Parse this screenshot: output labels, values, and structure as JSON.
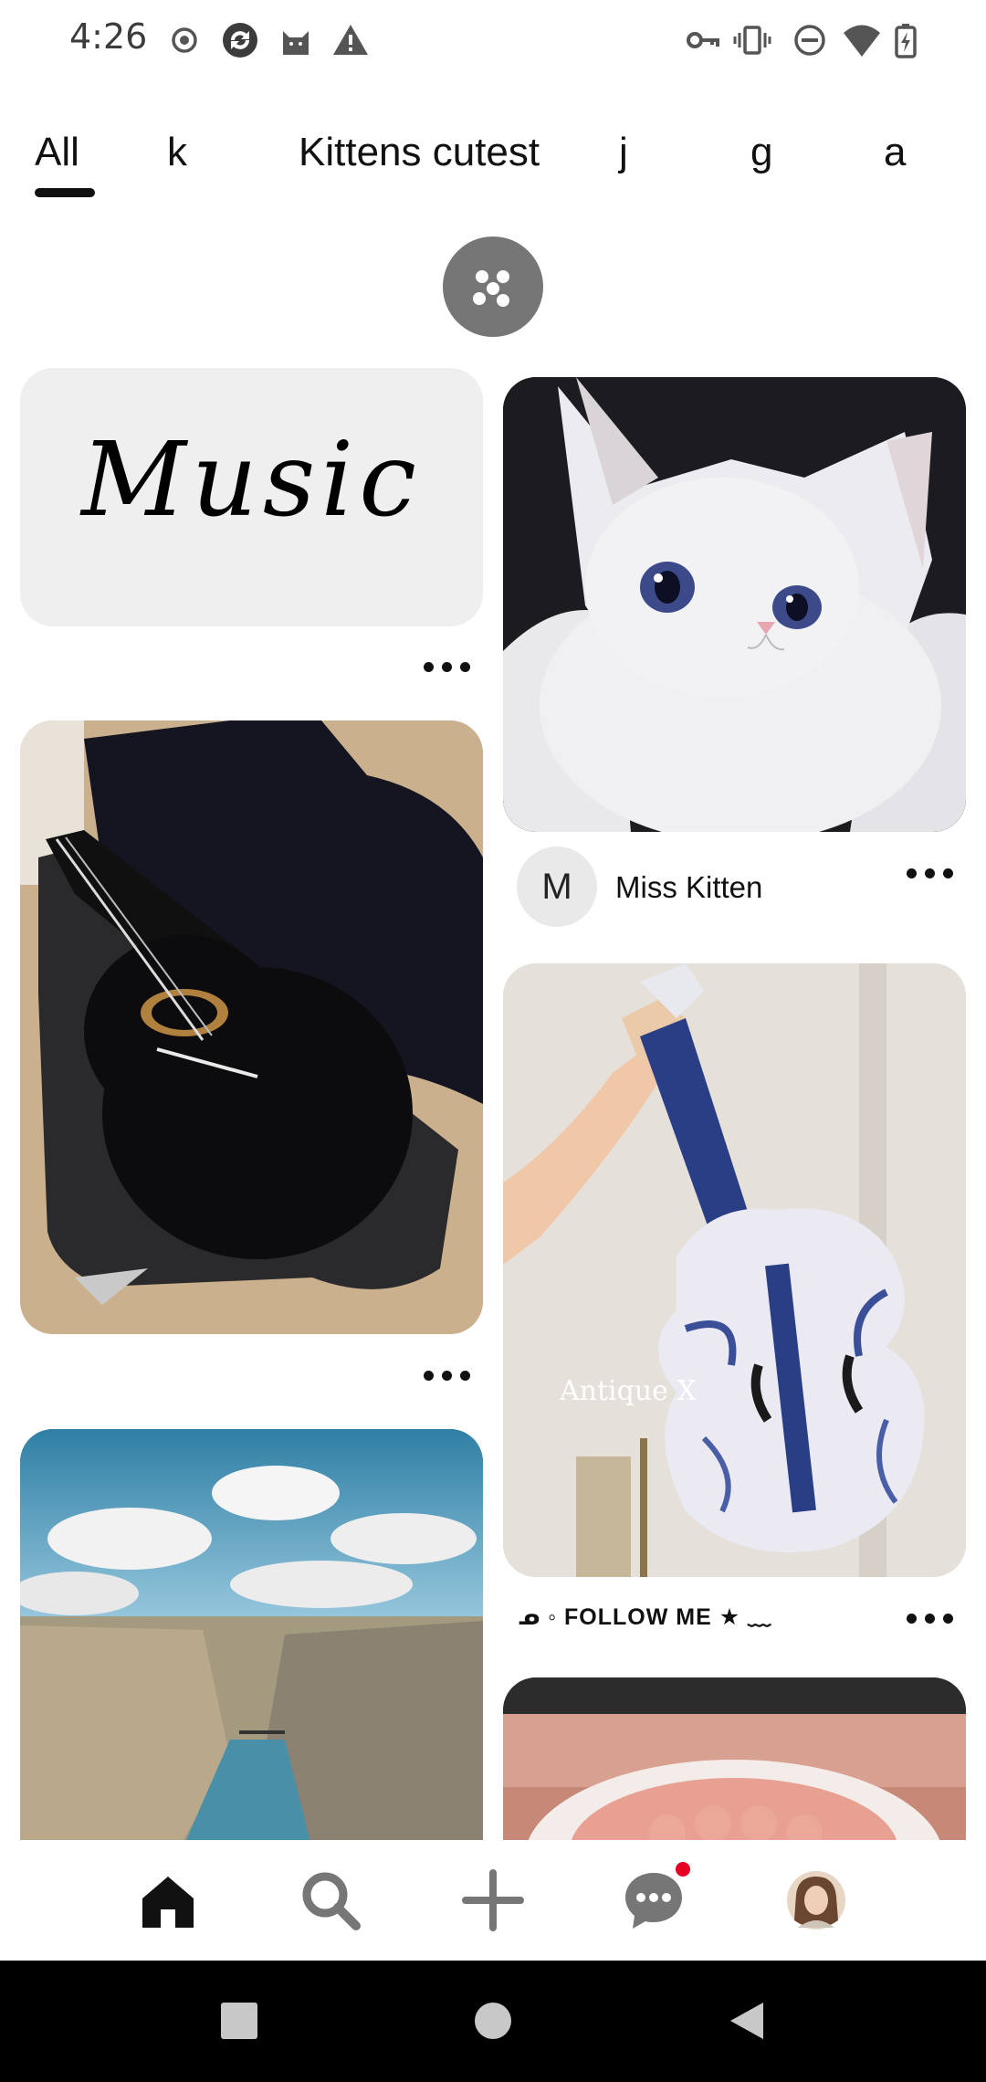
{
  "status_bar": {
    "time": "4:26",
    "left_icons": [
      "record-icon",
      "sync-icon",
      "cat-icon",
      "warning-icon"
    ],
    "right_icons": [
      "key-icon",
      "vibrate-icon",
      "dnd-icon",
      "wifi-icon",
      "battery-charging-icon"
    ]
  },
  "tabs": [
    {
      "label": "All",
      "selected": true
    },
    {
      "label": "k",
      "selected": false
    },
    {
      "label": "Kittens cutest",
      "selected": false
    },
    {
      "label": "j",
      "selected": false
    },
    {
      "label": "g",
      "selected": false
    },
    {
      "label": "a",
      "selected": false
    }
  ],
  "feed": {
    "pins": [
      {
        "id": "music",
        "image_text": "Music"
      },
      {
        "id": "guitar"
      },
      {
        "id": "landscape"
      },
      {
        "id": "kitten",
        "creator": {
          "initial": "M",
          "name": "Miss Kitten"
        }
      },
      {
        "id": "violin",
        "image_text": "Antique X",
        "caption": "ᓄ ◦  FOLLOW ME ★ ﹏"
      },
      {
        "id": "roses"
      }
    ]
  },
  "bottom_nav": {
    "items": [
      {
        "icon": "home-icon",
        "selected": true
      },
      {
        "icon": "search-icon"
      },
      {
        "icon": "plus-icon"
      },
      {
        "icon": "chat-icon",
        "notification": true
      },
      {
        "icon": "profile-avatar"
      }
    ]
  },
  "colors": {
    "notification": "#e60023",
    "shuffle_button": "#767676",
    "text": "#111111"
  }
}
